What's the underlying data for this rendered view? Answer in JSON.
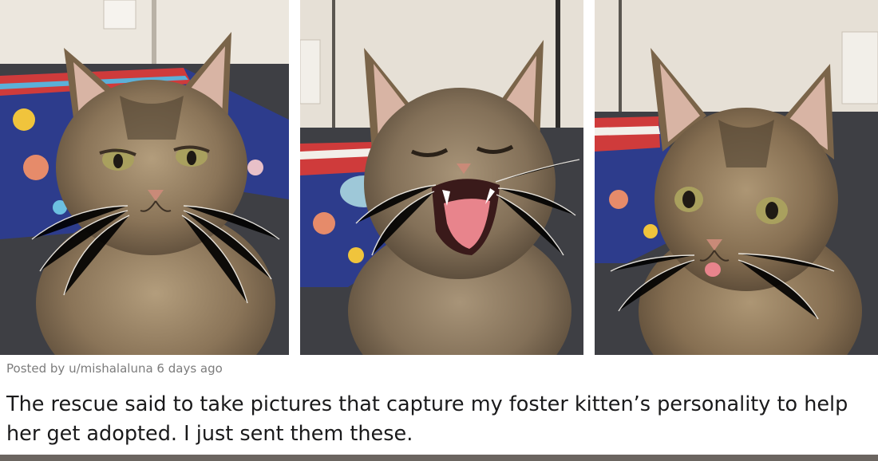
{
  "photos": [
    {
      "subject": "kitten-looking-grumpy"
    },
    {
      "subject": "kitten-yawning"
    },
    {
      "subject": "kitten-tongue-out"
    }
  ],
  "post": {
    "meta": "Posted by u/mishalaluna 6 days ago",
    "title": "The rescue said to take pictures that capture my foster kitten’s personality to help her get adopted. I just sent them these."
  },
  "colors": {
    "fur": "#8a7458",
    "fur_dark": "#4f4130",
    "wall": "#e6e0d6",
    "floor": "#3e3f44",
    "blanket": "#2d3c8c",
    "meta_text": "#7c7c7c",
    "title_text": "#1a1a1b"
  }
}
